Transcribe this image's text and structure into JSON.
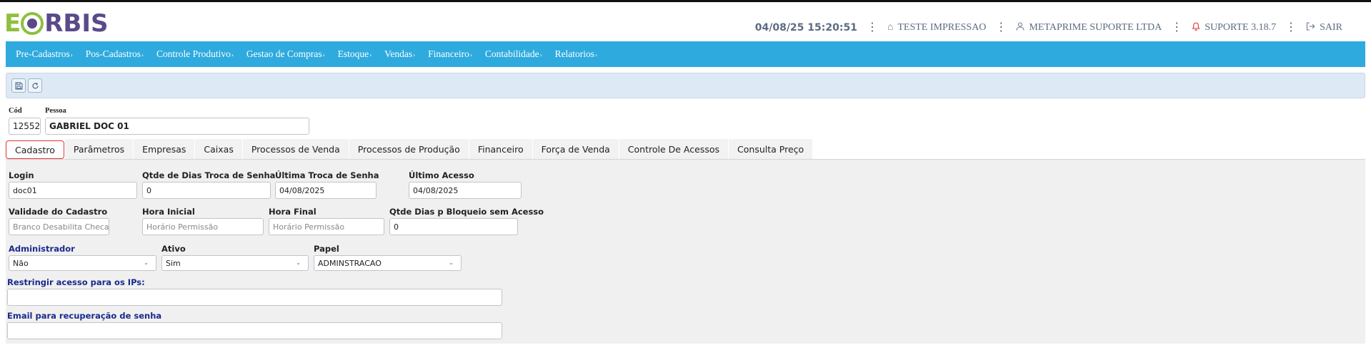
{
  "header": {
    "logo_text": "EORBIS",
    "datetime": "04/08/25 15:20:51",
    "printer_label": "TESTE IMPRESSAO",
    "company_label": "METAPRIME SUPORTE LTDA",
    "support_label": "SUPORTE 3.18.7",
    "logout_label": "SAIR"
  },
  "menu": {
    "items": [
      "Pre-Cadastros",
      "Pos-Cadastros",
      "Controle Produtivo",
      "Gestao de Compras",
      "Estoque",
      "Vendas",
      "Financeiro",
      "Contabilidade",
      "Relatorios"
    ]
  },
  "record": {
    "cod_label": "Cód",
    "cod_value": "12552",
    "pessoa_label": "Pessoa",
    "pessoa_value": "GABRIEL DOC 01"
  },
  "tabs": [
    "Cadastro",
    "Parâmetros",
    "Empresas",
    "Caixas",
    "Processos de Venda",
    "Processos de Produção",
    "Financeiro",
    "Força de Venda",
    "Controle De Acessos",
    "Consulta Preço"
  ],
  "form": {
    "login": {
      "label": "Login",
      "value": "doc01"
    },
    "qtde_dias_troca": {
      "label": "Qtde de Dias Troca de Senha",
      "value": "0"
    },
    "ultima_troca": {
      "label": "Última Troca de Senha",
      "value": "04/08/2025"
    },
    "ultimo_acesso": {
      "label": "Último Acesso",
      "value": "04/08/2025"
    },
    "validade": {
      "label": "Validade do Cadastro",
      "placeholder": "Branco Desabilita Checagem"
    },
    "hora_inicial": {
      "label": "Hora Inicial",
      "placeholder": "Horário Permissão"
    },
    "hora_final": {
      "label": "Hora Final",
      "placeholder": "Horário Permissão"
    },
    "qtde_bloqueio": {
      "label": "Qtde Dias p Bloqueio sem Acesso",
      "value": "0"
    },
    "administrador": {
      "label": "Administrador",
      "value": "Não"
    },
    "ativo": {
      "label": "Ativo",
      "value": "Sim"
    },
    "papel": {
      "label": "Papel",
      "value": "ADMINSTRACAO"
    },
    "restringir_ips": {
      "label": "Restringir acesso para os IPs:",
      "value": ""
    },
    "email_recuperacao": {
      "label": "Email para recuperação de senha",
      "value": ""
    }
  },
  "colors": {
    "menu_bg": "#2eaade",
    "toolbar_bg": "#dde9f4",
    "active_tab_border": "#e8342f",
    "logo_green": "#8fbf3f",
    "logo_purple": "#5a4a8a",
    "blue_label": "#1a2a8c"
  }
}
